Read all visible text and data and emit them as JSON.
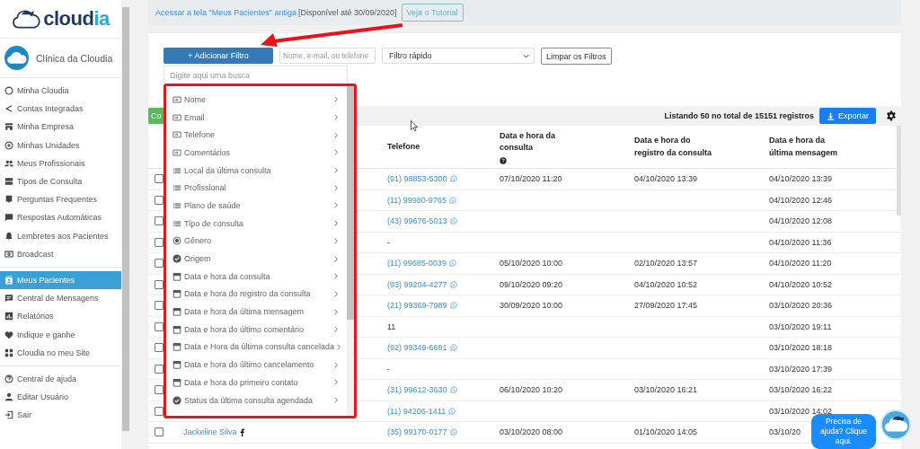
{
  "sidebar": {
    "logo": {
      "text": "cloud",
      "accent": "ia"
    },
    "clinic": "Clínica da Cloudia",
    "groups": [
      [
        {
          "label": "Minha Cloudia",
          "selected": false
        },
        {
          "label": "Contas Integradas",
          "selected": false
        },
        {
          "label": "Minha Empresa",
          "selected": false
        },
        {
          "label": "Minhas Unidades",
          "selected": false
        },
        {
          "label": "Meus Profissionais",
          "selected": false
        },
        {
          "label": "Tipos de Consulta",
          "selected": false
        },
        {
          "label": "Perguntas Frequentes",
          "selected": false
        },
        {
          "label": "Respostas Automáticas",
          "selected": false
        },
        {
          "label": "Lembretes aos Pacientes",
          "selected": false
        },
        {
          "label": "Broadcast",
          "selected": false
        }
      ],
      [
        {
          "label": "Meus Pacientes",
          "selected": true
        },
        {
          "label": "Central de Mensagens",
          "selected": false
        },
        {
          "label": "Relatórios",
          "selected": false
        },
        {
          "label": "Indique e ganhe",
          "selected": false
        },
        {
          "label": "Cloudia no meu Site",
          "selected": false
        }
      ],
      [
        {
          "label": "Central de ajuda",
          "selected": false
        },
        {
          "label": "Editar Usuário",
          "selected": false
        },
        {
          "label": "Sair",
          "selected": false
        }
      ]
    ]
  },
  "notice": {
    "link": "Acessar a tela \"Meus Pacientes\" antiga",
    "text": "[Disponível até 30/09/2020]",
    "button": "Veja o Tutorial"
  },
  "filters": {
    "add_button": "+ Adicionar Filtro",
    "search": {
      "placeholder": "Nome, e-mail, ou telefone"
    },
    "quick_filter": {
      "value": "Filtro rápido"
    },
    "clear_button": "Limpar os Filtros"
  },
  "filter_menu": {
    "search": {
      "placeholder": "Digite aqui uma busca"
    },
    "items": [
      {
        "label": "Nome",
        "kind": "text"
      },
      {
        "label": "Email",
        "kind": "text"
      },
      {
        "label": "Telefone",
        "kind": "text"
      },
      {
        "label": "Comentários",
        "kind": "text"
      },
      {
        "label": "Local da última consulta",
        "kind": "list"
      },
      {
        "label": "Profissional",
        "kind": "list"
      },
      {
        "label": "Plano de saúde",
        "kind": "list"
      },
      {
        "label": "Tipo de consulta",
        "kind": "list"
      },
      {
        "label": "Gênero",
        "kind": "radio"
      },
      {
        "label": "Origem",
        "kind": "check"
      },
      {
        "label": "Data e hora da consulta",
        "kind": "date"
      },
      {
        "label": "Data e hora do registro da consulta",
        "kind": "date"
      },
      {
        "label": "Data e hora da última mensagem",
        "kind": "date"
      },
      {
        "label": "Data e hora do último comentário",
        "kind": "date"
      },
      {
        "label": "Data e Hora da última consulta cancelada",
        "kind": "date"
      },
      {
        "label": "Data e hora do último cancelamento",
        "kind": "date"
      },
      {
        "label": "Data e hora do primeiro contato",
        "kind": "date"
      },
      {
        "label": "Status da última consulta agendada",
        "kind": "check"
      }
    ]
  },
  "toolbar": {
    "partial_button": "Co",
    "count": "Listando 50 no total de 15151 registros",
    "export_button": "Exportar"
  },
  "table": {
    "columns": [
      {
        "label": "Telefone",
        "help": false
      },
      {
        "label": "Data e hora da consulta",
        "help": true
      },
      {
        "label": "Data e hora do registro da consulta",
        "help": false
      },
      {
        "label": "Data e hora da última mensagem",
        "help": false
      }
    ],
    "rows": [
      {
        "checked": false,
        "phone": "(91) 98853-5300",
        "whatsapp": true,
        "consultation": "07/10/2020 11:20",
        "registered": "04/10/2020 13:39",
        "last_message": "04/10/2020 13:39"
      },
      {
        "checked": false,
        "phone": "(11) 99980-9765",
        "whatsapp": true,
        "last_message": "04/10/2020 12:46"
      },
      {
        "checked": false,
        "phone": "(43) 99676-5013",
        "whatsapp": true,
        "last_message": "04/10/2020 12:08"
      },
      {
        "checked": false,
        "phone": "-",
        "whatsapp": false,
        "last_message": "04/10/2020 11:36"
      },
      {
        "checked": false,
        "phone": "(11) 99685-0039",
        "whatsapp": true,
        "consultation": "05/10/2020 10:00",
        "registered": "02/10/2020 13:57",
        "last_message": "04/10/2020 11:20"
      },
      {
        "checked": false,
        "phone": "(93) 99204-4277",
        "whatsapp": true,
        "consultation": "09/10/2020 09:20",
        "registered": "04/10/2020 10:52",
        "last_message": "04/10/2020 10:52"
      },
      {
        "checked": false,
        "phone": "(21) 99369-7989",
        "whatsapp": true,
        "consultation": "30/09/2020 10:00",
        "registered": "27/09/2020 17:45",
        "last_message": "03/10/2020 20:36"
      },
      {
        "checked": false,
        "phone": "11",
        "whatsapp": false,
        "last_message": "03/10/2020 19:11"
      },
      {
        "checked": false,
        "phone": "(92) 99349-6691",
        "whatsapp": true,
        "last_message": "03/10/2020 18:18"
      },
      {
        "checked": false,
        "phone": "-",
        "whatsapp": false,
        "last_message": "03/10/2020 17:39"
      },
      {
        "checked": false,
        "phone": "(31) 99612-3630",
        "whatsapp": true,
        "consultation": "06/10/2020 10:20",
        "registered": "03/10/2020 16:21",
        "last_message": "03/10/2020 16:22"
      },
      {
        "checked": false,
        "phone": "(11) 94206-1411",
        "whatsapp": true,
        "last_message": "03/10/2020 14:02"
      },
      {
        "checked": false,
        "name": "Jackeline Silva",
        "facebook": true,
        "phone": "(35) 99170-0177",
        "whatsapp": true,
        "consultation": "03/10/2020 08:00",
        "registered": "01/10/2020 14:05",
        "last_message": "03/10/20"
      }
    ]
  },
  "help_chat": {
    "text": "Precisa de ajuda? Clique aqui."
  }
}
